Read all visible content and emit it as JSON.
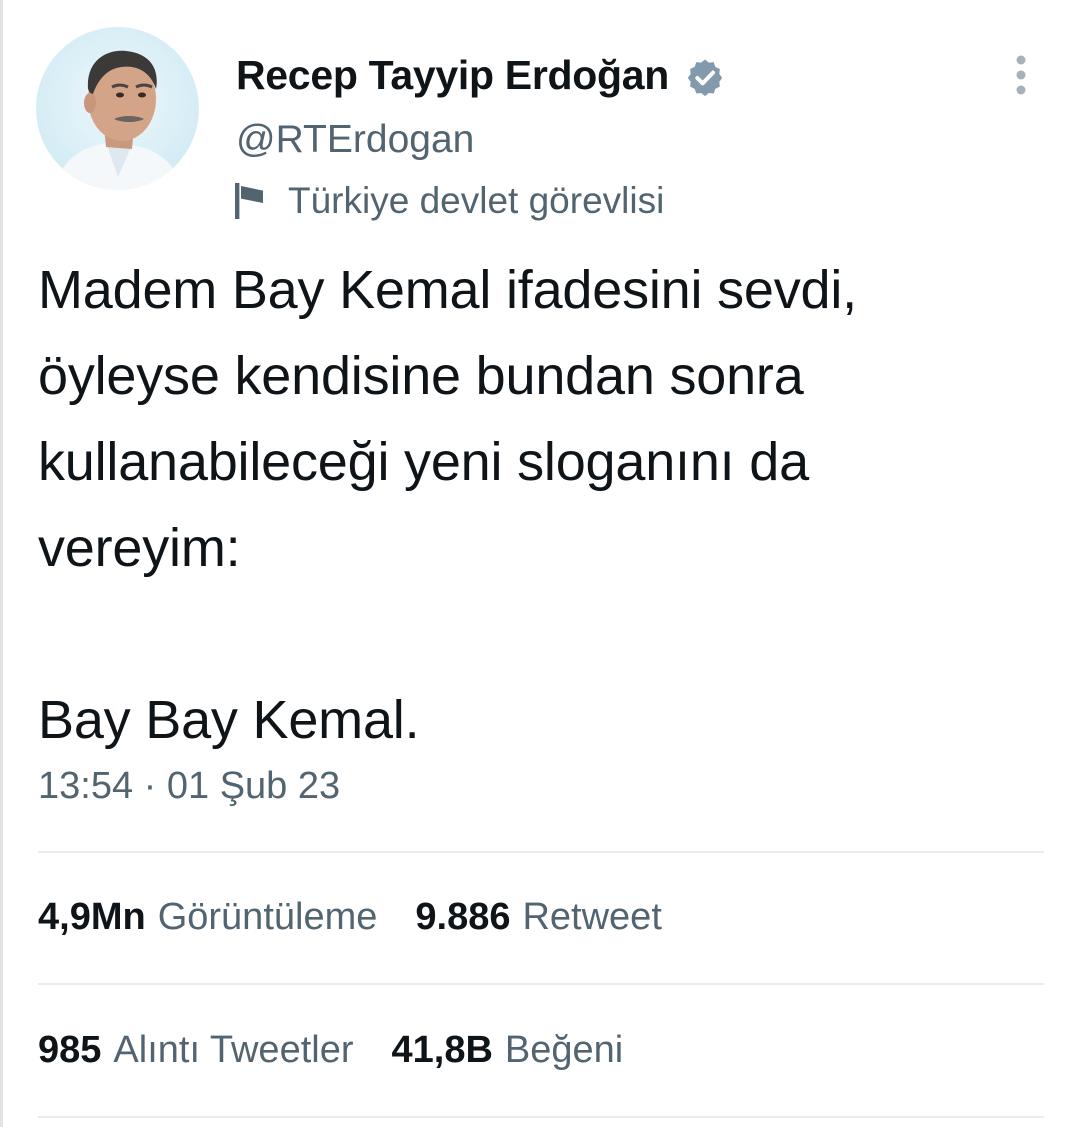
{
  "author": {
    "display_name": "Recep Tayyip Erdoğan",
    "handle": "@RTErdogan",
    "account_label": "Türkiye devlet görevlisi",
    "verified_badge_color": "#829aab"
  },
  "tweet": {
    "text": "Madem Bay Kemal ifadesini sevdi,\nöyleyse kendisine bundan sonra\nkullanabileceği yeni sloganını da\nvereyim:\n\nBay Bay Kemal.",
    "timestamp": "13:54 · 01 Şub 23"
  },
  "stats": {
    "views": {
      "count": "4,9Mn",
      "label": "Görüntüleme"
    },
    "retweets": {
      "count": "9.886",
      "label": "Retweet"
    },
    "quotes": {
      "count": "985",
      "label": "Alıntı Tweetler"
    },
    "likes": {
      "count": "41,8B",
      "label": "Beğeni"
    }
  },
  "icons": {
    "avatar": "profile-photo",
    "verified": "verified-badge-icon",
    "label": "flag-icon",
    "more": "more-vertical-icon"
  },
  "colors": {
    "text_primary": "#0f1419",
    "text_secondary": "#536471",
    "divider": "#e6ecf0"
  }
}
